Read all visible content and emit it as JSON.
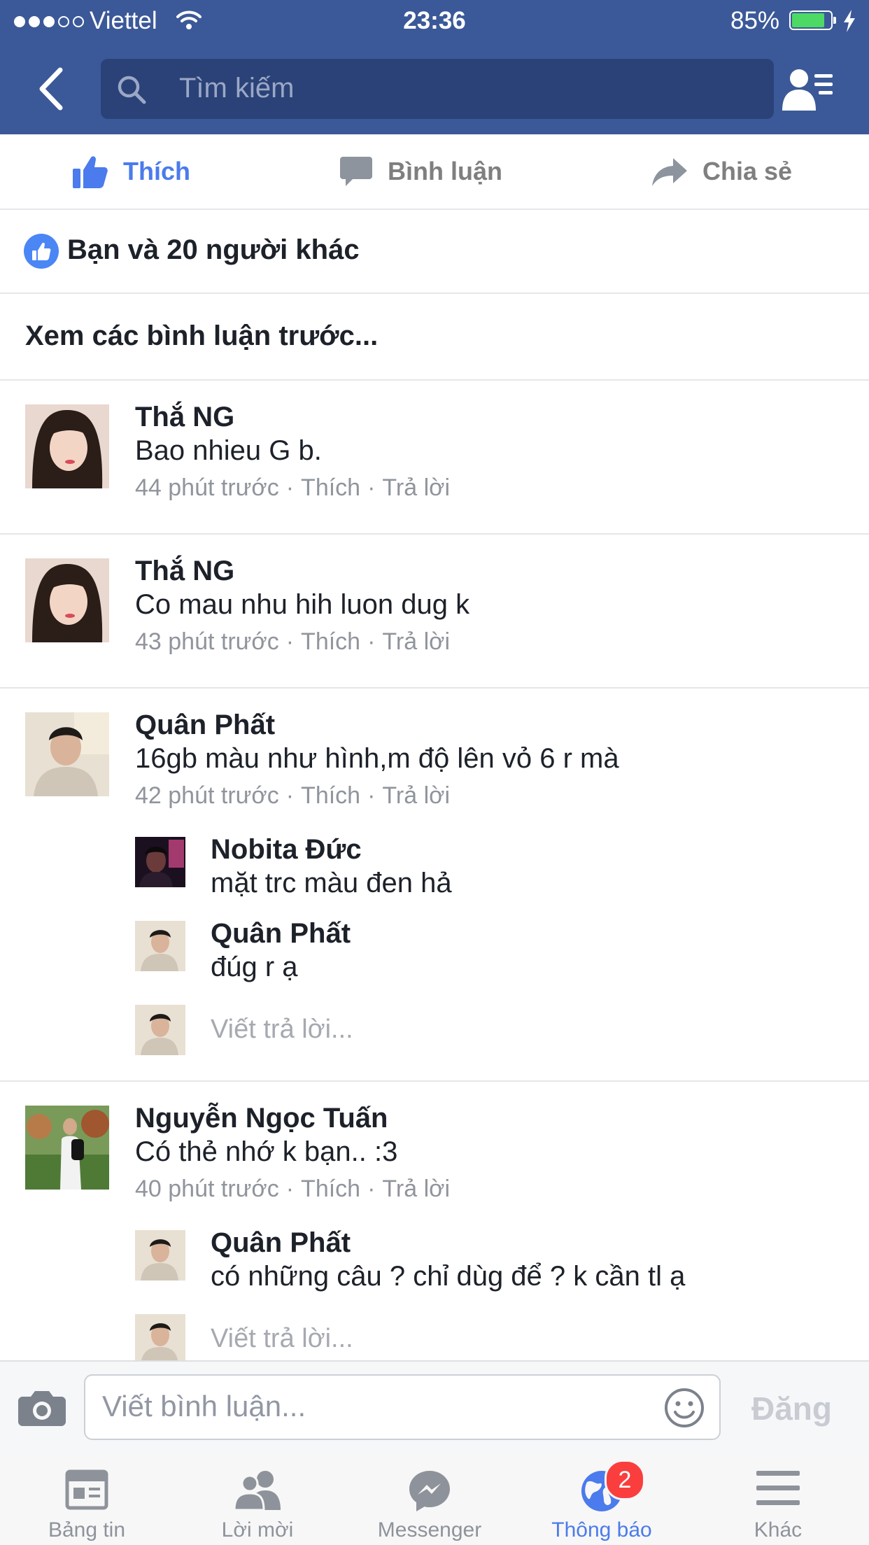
{
  "status_bar": {
    "carrier": "Viettel",
    "time": "23:36",
    "battery": "85%",
    "battery_level": 0.85,
    "signal_bars_filled": 3,
    "signal_bars_total": 5
  },
  "header": {
    "search_placeholder": "Tìm kiếm",
    "back_icon": "chevron-left-icon",
    "friends_icon": "friend-requests-icon"
  },
  "actions": {
    "like": "Thích",
    "comment": "Bình luận",
    "share": "Chia sẻ"
  },
  "likes": {
    "summary": "Bạn và 20 người khác"
  },
  "previous_comments": "Xem các bình luận trước...",
  "comments": [
    {
      "name": "Thắ NG",
      "text": "Bao nhieu G b.",
      "time": "44 phút trước",
      "like": "Thích",
      "reply": "Trả lời"
    },
    {
      "name": "Thắ NG",
      "text": "Co mau nhu hih luon dug k",
      "time": "43 phút trước",
      "like": "Thích",
      "reply": "Trả lời"
    },
    {
      "name": "Quân Phất",
      "text": "16gb màu như hình,m độ lên vỏ 6 r mà",
      "time": "42 phút trước",
      "like": "Thích",
      "reply": "Trả lời",
      "replies": [
        {
          "name": "Nobita Đức",
          "text": "mặt trc màu đen hả"
        },
        {
          "name": "Quân Phất",
          "text": "đúg r ạ"
        }
      ],
      "reply_placeholder": "Viết trả lời..."
    },
    {
      "name": "Nguyễn Ngọc Tuấn",
      "text": "Có thẻ nhớ k bạn.. :3",
      "time": "40 phút trước",
      "like": "Thích",
      "reply": "Trả lời",
      "replies": [
        {
          "name": "Quân Phất",
          "text": "có những câu ? chỉ dùg để ? k cần tl ạ"
        }
      ],
      "reply_placeholder": "Viết trả lời..."
    }
  ],
  "composer": {
    "placeholder": "Viết bình luận...",
    "post": "Đăng"
  },
  "tabs": [
    {
      "label": "Bảng tin",
      "icon": "news-feed-icon"
    },
    {
      "label": "Lời mời",
      "icon": "friend-requests-icon"
    },
    {
      "label": "Messenger",
      "icon": "messenger-icon"
    },
    {
      "label": "Thông báo",
      "icon": "globe-notifications-icon",
      "badge": "2",
      "active": true
    },
    {
      "label": "Khác",
      "icon": "menu-icon"
    }
  ],
  "colors": {
    "header": "#3b5998",
    "accent": "#4b7bec",
    "badge": "#fa3e3e"
  }
}
